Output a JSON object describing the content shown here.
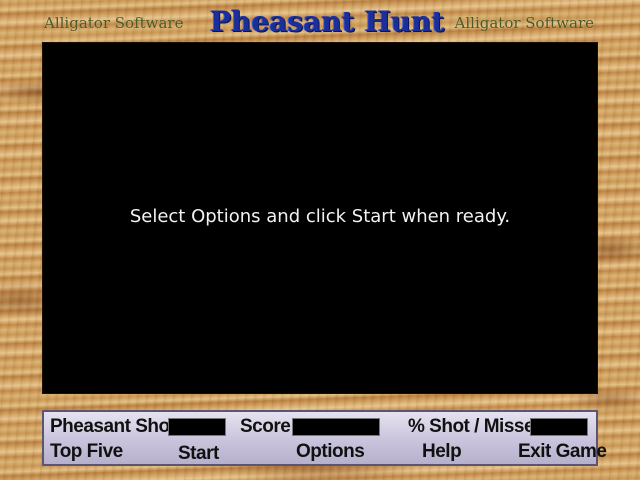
{
  "header": {
    "title": "Pheasant Hunt",
    "brand_left": "Alligator Software",
    "brand_right": "Alligator Software"
  },
  "playfield": {
    "message": "Select Options and click Start when ready."
  },
  "status_bar": {
    "pheasant_shot_label": "Pheasant Shot",
    "pheasant_shot_value": "",
    "score_label": "Score",
    "score_value": "",
    "shot_missed_label": "% Shot / Missed",
    "shot_missed_value": ""
  },
  "menu": {
    "top_five": "Top Five",
    "start": "Start",
    "options": "Options",
    "help": "Help",
    "exit_game": "Exit Game"
  },
  "colors": {
    "title": "#1b2f9c",
    "brand": "#4a5a2a",
    "playfield": "#000000",
    "panel": "#c9c4dc",
    "wood_light": "#e2bf83",
    "wood_dark": "#b97f3f"
  }
}
